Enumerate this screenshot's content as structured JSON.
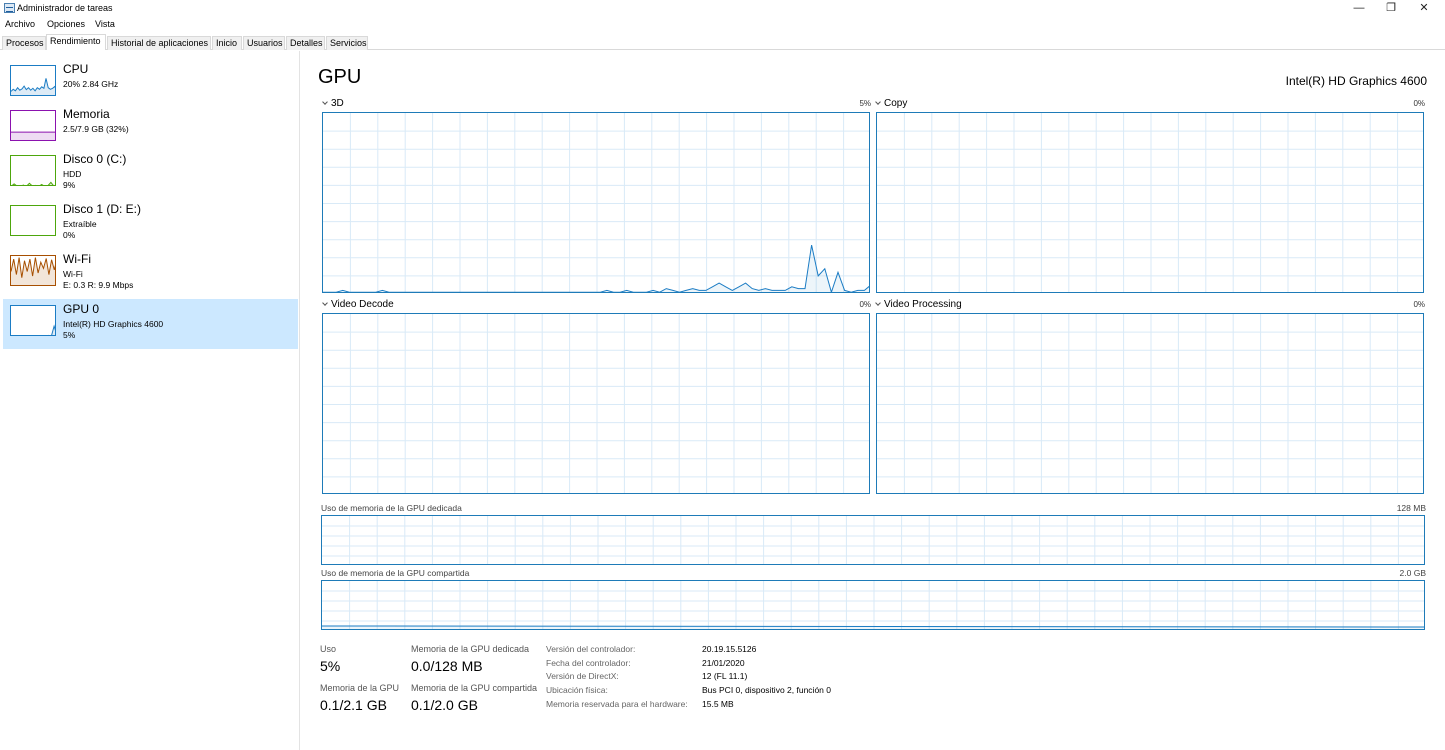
{
  "window": {
    "title": "Administrador de tareas",
    "controls": {
      "minimize": "—",
      "maximize": "❐",
      "close": "✕"
    }
  },
  "menu": [
    "Archivo",
    "Opciones",
    "Vista"
  ],
  "tabs": [
    "Procesos",
    "Rendimiento",
    "Historial de aplicaciones",
    "Inicio",
    "Usuarios",
    "Detalles",
    "Servicios"
  ],
  "active_tab": "Rendimiento",
  "sidebar": {
    "items": [
      {
        "title": "CPU",
        "line1": "20%  2.84 GHz",
        "line2": "",
        "color": "#1b7cc4",
        "history": [
          0.18,
          0.25,
          0.2,
          0.3,
          0.22,
          0.26,
          0.35,
          0.24,
          0.3,
          0.22,
          0.28,
          0.2,
          0.3,
          0.25,
          0.33,
          0.28,
          0.6,
          0.3,
          0.25,
          0.28,
          0.34,
          0.22
        ]
      },
      {
        "title": "Memoria",
        "line1": "2.5/7.9 GB (32%)",
        "line2": "",
        "color": "#8b12ae",
        "history": [
          0.32,
          0.32,
          0.32,
          0.32,
          0.32,
          0.32,
          0.32,
          0.32,
          0.32,
          0.32,
          0.32,
          0.32
        ]
      },
      {
        "title": "Disco 0 (C:)",
        "line1": "HDD",
        "line2": "9%",
        "color": "#4da60c",
        "history": [
          0.02,
          0.1,
          0.03,
          0.02,
          0.06,
          0.02,
          0.12,
          0.03,
          0.05,
          0.02,
          0.08,
          0.02,
          0.04,
          0.15,
          0.03,
          0.09
        ]
      },
      {
        "title": "Disco 1 (D: E:)",
        "line1": "Extraíble",
        "line2": "0%",
        "color": "#4da60c",
        "history": [
          0,
          0,
          0,
          0,
          0,
          0,
          0,
          0
        ]
      },
      {
        "title": "Wi-Fi",
        "line1": "Wi-Fi",
        "line2": "E: 0.3  R: 9.9 Mbps",
        "color": "#a74f01",
        "history": [
          0.5,
          0.9,
          0.4,
          0.95,
          0.3,
          0.85,
          0.5,
          0.9,
          0.35,
          0.95,
          0.45,
          0.8,
          0.6,
          0.92,
          0.4,
          0.88,
          0.55,
          0.9
        ]
      },
      {
        "title": "GPU 0",
        "line1": "Intel(R) HD Graphics 4600",
        "line2": "5%",
        "color": "#1b7cc4",
        "history": [
          0.01,
          0.01,
          0.02,
          0.01,
          0.01,
          0.02,
          0.01,
          0.01,
          0.02,
          0.01,
          0.02,
          0.03,
          0.02,
          0.05,
          0.02,
          0.35,
          0.05
        ]
      }
    ],
    "selected_index": 5
  },
  "main": {
    "heading": "GPU",
    "model": "Intel(R) HD Graphics 4600",
    "engines": [
      {
        "label": "3D",
        "pct": "5%"
      },
      {
        "label": "Copy",
        "pct": "0%"
      },
      {
        "label": "Video Decode",
        "pct": "0%"
      },
      {
        "label": "Video Processing",
        "pct": "0%"
      }
    ],
    "dedicated_label": "Uso de memoria de la GPU dedicada",
    "dedicated_max": "128 MB",
    "shared_label": "Uso de memoria de la GPU compartida",
    "shared_max": "2.0 GB",
    "stats": [
      {
        "label": "Uso",
        "value": "5%"
      },
      {
        "label": "Memoria de la GPU dedicada",
        "value": "0.0/128 MB"
      },
      {
        "label": "Memoria de la GPU",
        "value": "0.1/2.1 GB"
      },
      {
        "label": "Memoria de la GPU compartida",
        "value": "0.1/2.0 GB"
      }
    ],
    "info": [
      {
        "label": "Versión del controlador:",
        "value": "20.19.15.5126"
      },
      {
        "label": "Fecha del controlador:",
        "value": "21/01/2020"
      },
      {
        "label": "Versión de DirectX:",
        "value": "12 (FL 11.1)"
      },
      {
        "label": "Ubicación física:",
        "value": "Bus PCI 0, dispositivo 2, función 0"
      },
      {
        "label": "Memoria reservada para el hardware:",
        "value": "15.5 MB"
      }
    ]
  },
  "chart_data": {
    "type": "line",
    "series": [
      {
        "values": [
          0.01,
          0.01,
          0.01,
          0.02,
          0.01,
          0.01,
          0.01,
          0.01,
          0.01,
          0.02,
          0.01,
          0.01,
          0.01,
          0.01,
          0.01,
          0.01,
          0.01,
          0.01,
          0.01,
          0.01,
          0.01,
          0.01,
          0.01,
          0.01,
          0.01,
          0.01,
          0.01,
          0.01,
          0.01,
          0.01,
          0.01,
          0.01,
          0.01,
          0.01,
          0.01,
          0.01,
          0.01,
          0.01,
          0.01,
          0.01,
          0.01,
          0.01,
          0.01,
          0.02,
          0.01,
          0.01,
          0.02,
          0.01,
          0.01,
          0.01,
          0.02,
          0.01,
          0.03,
          0.02,
          0.01,
          0.02,
          0.03,
          0.02,
          0.02,
          0.04,
          0.06,
          0.04,
          0.02,
          0.04,
          0.06,
          0.03,
          0.02,
          0.03,
          0.02,
          0.02,
          0.02,
          0.04,
          0.03,
          0.03,
          0.27,
          0.1,
          0.14,
          0.01,
          0.12,
          0.02,
          0.01,
          0.02,
          0.02,
          0.05
        ]
      }
    ],
    "ylim": [
      0,
      1
    ]
  }
}
